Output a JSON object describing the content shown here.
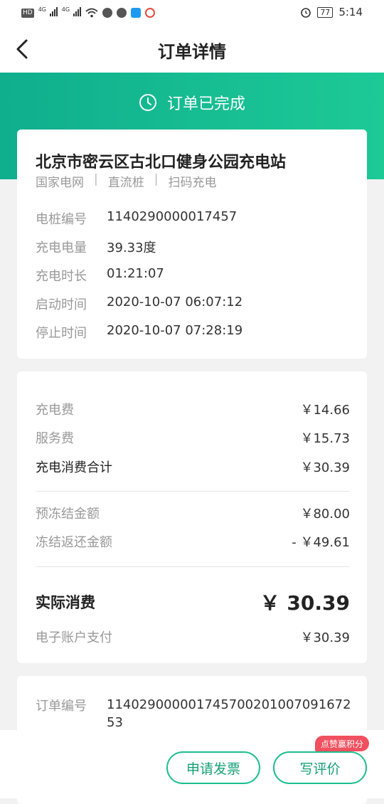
{
  "status_bar": {
    "hd": "HD",
    "sig1": "4G",
    "sig2": "4G",
    "battery": "77",
    "time": "5:14",
    "colors": {
      "app_blue": "#1e9bf0",
      "app_red": "#e84a3c"
    }
  },
  "nav": {
    "title": "订单详情",
    "back_icon": "chevron-left-icon"
  },
  "banner": {
    "status_text": "订单已完成",
    "status_icon": "clock-icon",
    "gradient": [
      "#0fae8d",
      "#1dca96"
    ]
  },
  "station": {
    "name": "北京市密云区古北口健身公园充电站",
    "tags": [
      "国家电网",
      "直流桩",
      "扫码充电"
    ],
    "separator": "|",
    "details": [
      {
        "label": "电桩编号",
        "value": "1140290000017457"
      },
      {
        "label": "充电电量",
        "value": "39.33度"
      },
      {
        "label": "充电时长",
        "value": "01:21:07"
      },
      {
        "label": "启动时间",
        "value": "2020-10-07 06:07:12"
      },
      {
        "label": "停止时间",
        "value": "2020-10-07 07:28:19"
      }
    ]
  },
  "fees": {
    "charge_fee": {
      "label": "充电费",
      "value": "￥14.66"
    },
    "service_fee": {
      "label": "服务费",
      "value": "￥15.73"
    },
    "subtotal": {
      "label": "充电消费合计",
      "value": "￥30.39"
    },
    "frozen": {
      "label": "预冻结金额",
      "value": "￥80.00"
    },
    "refund": {
      "label": "冻结返还金额",
      "value": "- ￥49.61"
    },
    "actual": {
      "label": "实际消费",
      "value": "￥ 30.39"
    },
    "payment": {
      "label": "电子账户支付",
      "value": "￥30.39"
    }
  },
  "order": {
    "label": "订单编号",
    "value": "11402900000174570020100709167253"
  },
  "actions": {
    "invoice_label": "申请发票",
    "review_label": "写评价",
    "badge_text": "点赞赢积分",
    "accent": "#1dbf8e",
    "badge_color": "#f0505f"
  }
}
